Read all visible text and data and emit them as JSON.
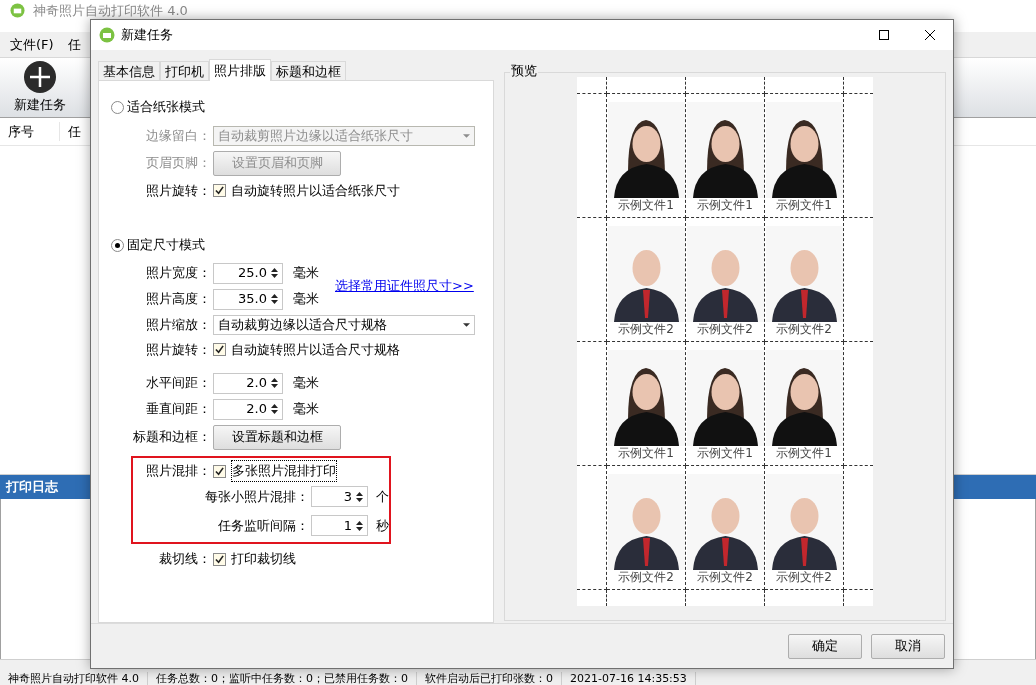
{
  "app": {
    "title": "神奇照片自动打印软件 4.0",
    "menu": [
      "文件(F)",
      "任"
    ],
    "toolbar": [
      {
        "label": "新建任务"
      }
    ],
    "table": {
      "columns": [
        "序号",
        "任"
      ]
    },
    "log_panel": {
      "title": "打印日志"
    },
    "status_bar": [
      "神奇照片自动打印软件 4.0",
      "任务总数：0；监听中任务数：0；已禁用任务数：0",
      "软件启动后已打印张数：0",
      "2021-07-16 14:35:53"
    ]
  },
  "dialog": {
    "title": "新建任务",
    "tabs": [
      {
        "label": "基本信息",
        "selected": false
      },
      {
        "label": "打印机",
        "selected": false
      },
      {
        "label": "照片排版",
        "selected": true
      },
      {
        "label": "标题和边框",
        "selected": false
      }
    ],
    "fit_mode": {
      "label": "适合纸张模式",
      "selected": false,
      "rows": [
        {
          "kind": "select",
          "label": "边缘留白：",
          "value": "自动裁剪照片边缘以适合纸张尺寸",
          "disabled": true
        },
        {
          "kind": "button",
          "label": "页眉页脚：",
          "button": "设置页眉和页脚",
          "disabled": true
        },
        {
          "kind": "checkbox",
          "label": "照片旋转：",
          "text": "自动旋转照片以适合纸张尺寸",
          "checked": true
        }
      ]
    },
    "fixed_mode": {
      "label": "固定尺寸模式",
      "selected": true,
      "link": "选择常用证件照尺寸>>",
      "size_rows": [
        {
          "label": "照片宽度：",
          "value": "25.0",
          "unit": "毫米"
        },
        {
          "label": "照片高度：",
          "value": "35.0",
          "unit": "毫米"
        }
      ],
      "rows": [
        {
          "kind": "select",
          "label": "照片缩放：",
          "value": "自动裁剪边缘以适合尺寸规格",
          "disabled": false
        },
        {
          "kind": "checkbox",
          "label": "照片旋转：",
          "text": "自动旋转照片以适合尺寸规格",
          "checked": true
        },
        {
          "kind": "spin",
          "label": "水平间距：",
          "value": "2.0",
          "unit": "毫米"
        },
        {
          "kind": "spin",
          "label": "垂直间距：",
          "value": "2.0",
          "unit": "毫米"
        },
        {
          "kind": "button",
          "label": "标题和边框：",
          "button": "设置标题和边框",
          "disabled": false
        }
      ]
    },
    "mix": {
      "highlighted": true,
      "label": "照片混排：",
      "text": "多张照片混排打印",
      "checked": true,
      "rows": [
        {
          "label": "每张小照片混排：",
          "value": "3",
          "unit": "个"
        },
        {
          "label": "任务监听间隔：",
          "value": "1",
          "unit": "秒"
        }
      ]
    },
    "cut_line": {
      "label": "裁切线：",
      "text": "打印裁切线",
      "checked": true
    },
    "preview": {
      "title": "预览",
      "rows": [
        {
          "photos": [
            {
              "kind": "woman",
              "caption": "示例文件1"
            },
            {
              "kind": "woman",
              "caption": "示例文件1"
            },
            {
              "kind": "woman",
              "caption": "示例文件1"
            }
          ]
        },
        {
          "photos": [
            {
              "kind": "man",
              "caption": "示例文件2"
            },
            {
              "kind": "man",
              "caption": "示例文件2"
            },
            {
              "kind": "man",
              "caption": "示例文件2"
            }
          ]
        },
        {
          "photos": [
            {
              "kind": "woman",
              "caption": "示例文件1"
            },
            {
              "kind": "woman",
              "caption": "示例文件1"
            },
            {
              "kind": "woman",
              "caption": "示例文件1"
            }
          ]
        },
        {
          "photos": [
            {
              "kind": "man",
              "caption": "示例文件2"
            },
            {
              "kind": "man",
              "caption": "示例文件2"
            },
            {
              "kind": "man",
              "caption": "示例文件2"
            }
          ]
        }
      ]
    },
    "buttons": [
      "确定",
      "取消"
    ]
  }
}
